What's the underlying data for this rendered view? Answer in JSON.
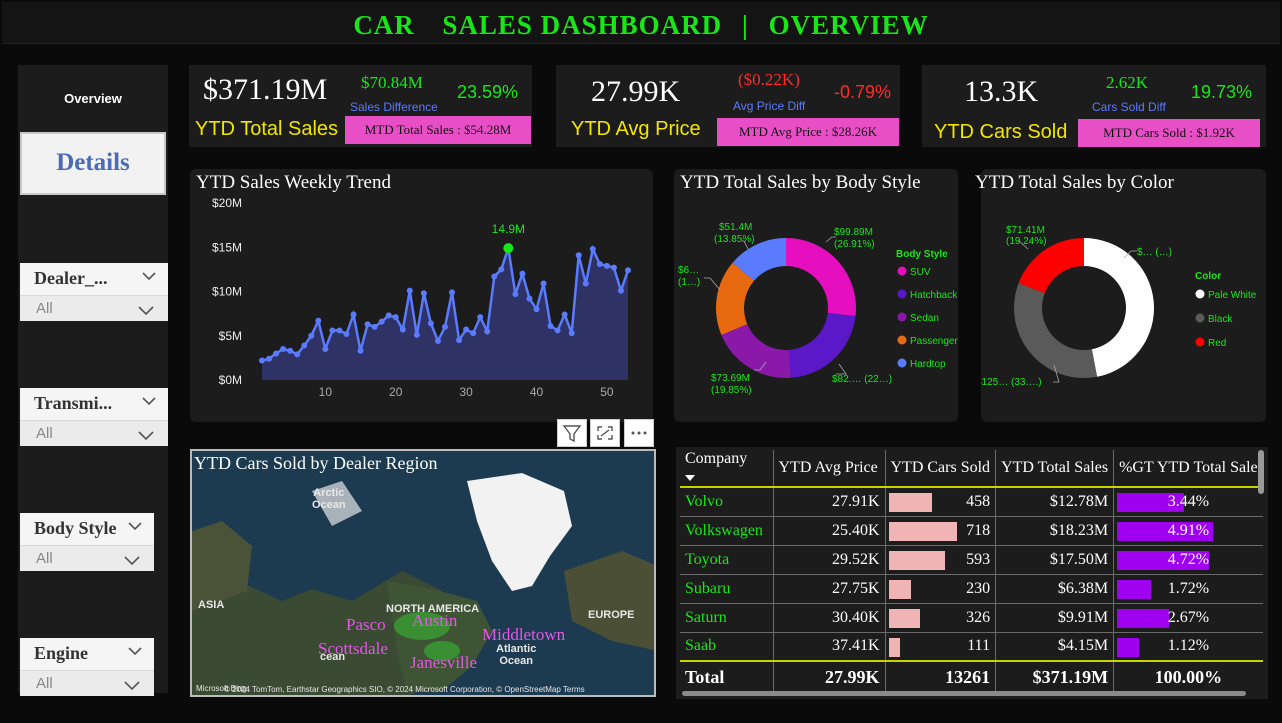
{
  "header": {
    "title_left": "CAR",
    "title_mid": "SALES DASHBOARD",
    "title_sep": "|",
    "title_right": "OVERVIEW"
  },
  "nav": {
    "overview": "Overview",
    "details": "Details"
  },
  "slicers": [
    {
      "label": "Dealer_...",
      "value": "All"
    },
    {
      "label": "Transmi...",
      "value": "All"
    },
    {
      "label": "Body Style",
      "value": "All"
    },
    {
      "label": "Engine",
      "value": "All"
    }
  ],
  "kpis": [
    {
      "value": "$371.19M",
      "label": "YTD Total Sales",
      "diff": "$70.84M",
      "diff_label": "Sales Difference",
      "pct": "23.59%",
      "mtd": "MTD Total Sales : $54.28M",
      "diff_color": "#19e619"
    },
    {
      "value": "27.99K",
      "label": "YTD Avg Price",
      "diff": "($0.22K)",
      "diff_label": "Avg Price Diff",
      "pct": "-0.79%",
      "mtd": "MTD Avg Price : $28.26K",
      "diff_color": "#ff2a2a"
    },
    {
      "value": "13.3K",
      "label": "YTD Cars Sold",
      "diff": "2.62K",
      "diff_label": "Cars Sold Diff",
      "pct": "19.73%",
      "mtd": "MTD Cars Sold : $1.92K",
      "diff_color": "#19e619"
    }
  ],
  "trend": {
    "title": "YTD Sales Weekly Trend",
    "peak_label": "14.9M",
    "chart_data": {
      "type": "area",
      "x": [
        1,
        2,
        3,
        4,
        5,
        6,
        7,
        8,
        9,
        10,
        11,
        12,
        13,
        14,
        15,
        16,
        17,
        18,
        19,
        20,
        21,
        22,
        23,
        24,
        25,
        26,
        27,
        28,
        29,
        30,
        31,
        32,
        33,
        34,
        35,
        36,
        37,
        38,
        39,
        40,
        41,
        42,
        43,
        44,
        45,
        46,
        47,
        48,
        49,
        50,
        51,
        52,
        53
      ],
      "values": [
        2.2,
        2.4,
        3.0,
        3.5,
        3.3,
        2.9,
        3.9,
        5.0,
        6.7,
        3.5,
        5.6,
        5.6,
        5.2,
        7.4,
        3.3,
        6.3,
        6.0,
        6.6,
        7.3,
        7.1,
        5.7,
        10.1,
        5.1,
        9.8,
        6.4,
        4.4,
        6.0,
        9.9,
        4.5,
        5.7,
        5.3,
        7.1,
        5.5,
        11.7,
        12.5,
        14.9,
        9.7,
        12.0,
        9.2,
        8.0,
        10.9,
        6.1,
        5.6,
        7.4,
        5.3,
        14.1,
        10.9,
        14.8,
        13.1,
        12.9,
        12.7,
        10.1,
        12.4,
        1.0
      ],
      "yticks": [
        "$0M",
        "$5M",
        "$10M",
        "$15M",
        "$20M"
      ],
      "xticks": [
        10,
        20,
        30,
        40,
        50
      ],
      "ylim": [
        0,
        20
      ],
      "xlim": [
        1,
        53
      ]
    }
  },
  "body_style": {
    "title": "YTD Total Sales by Body Style",
    "legend_title": "Body Style",
    "chart_data": {
      "type": "pie",
      "categories": [
        "SUV",
        "Hatchback",
        "Sedan",
        "Passenger",
        "Hardtop"
      ],
      "values": [
        99.89,
        82.0,
        73.69,
        65.0,
        51.4
      ],
      "colors": [
        "#e60fbf",
        "#5b18c8",
        "#8a18a8",
        "#e86a10",
        "#5b7bff"
      ],
      "labels": [
        "$99.89M\n(26.91%)",
        "$82.... (22...)",
        "$73.69M\n(19.85%)",
        "$6...\n(1...)",
        "$51.4M\n(13.85%)"
      ]
    }
  },
  "color": {
    "title": "YTD Total Sales by Color",
    "legend_title": "Color",
    "chart_data": {
      "type": "pie",
      "categories": [
        "Pale White",
        "Black",
        "Red"
      ],
      "values": [
        174.5,
        125.3,
        71.41
      ],
      "colors": [
        "#ffffff",
        "#5a5a5a",
        "#ff0000"
      ],
      "labels": [
        "$... (...)",
        "$125... (33....)",
        "$71.41M\n(19.24%)"
      ]
    }
  },
  "map": {
    "title": "YTD Cars Sold by Dealer Region",
    "labels": {
      "arctic": "Arctic\nOcean",
      "asia": "ASIA",
      "na": "NORTH AMERICA",
      "europe": "EUROPE",
      "pacific": "cean",
      "atlantic": "Atlantic\nOcean"
    },
    "cities": [
      "Pasco",
      "Austin",
      "Middletown",
      "Scottsdale",
      "Janesville"
    ],
    "attribution": "© 2024 TomTom, Earthstar Geographics SIO, © 2024 Microsoft Corporation, © OpenStreetMap Terms",
    "brand": "Microsoft Bing"
  },
  "table": {
    "headers": [
      "Company",
      "YTD Avg Price",
      "YTD Cars Sold",
      "YTD Total Sales",
      "%GT YTD Total Sale"
    ],
    "rows": [
      {
        "company": "Volvo",
        "avg": "27.91K",
        "sold": "458",
        "sold_n": 458,
        "sales": "$12.78M",
        "pct": "3.44%",
        "pct_n": 3.44
      },
      {
        "company": "Volkswagen",
        "avg": "25.40K",
        "sold": "718",
        "sold_n": 718,
        "sales": "$18.23M",
        "pct": "4.91%",
        "pct_n": 4.91
      },
      {
        "company": "Toyota",
        "avg": "29.52K",
        "sold": "593",
        "sold_n": 593,
        "sales": "$17.50M",
        "pct": "4.72%",
        "pct_n": 4.72
      },
      {
        "company": "Subaru",
        "avg": "27.75K",
        "sold": "230",
        "sold_n": 230,
        "sales": "$6.38M",
        "pct": "1.72%",
        "pct_n": 1.72
      },
      {
        "company": "Saturn",
        "avg": "30.40K",
        "sold": "326",
        "sold_n": 326,
        "sales": "$9.91M",
        "pct": "2.67%",
        "pct_n": 2.67
      },
      {
        "company": "Saab",
        "avg": "37.41K",
        "sold": "111",
        "sold_n": 111,
        "sales": "$4.15M",
        "pct": "1.12%",
        "pct_n": 1.12
      }
    ],
    "total": {
      "label": "Total",
      "avg": "27.99K",
      "sold": "13261",
      "sales": "$371.19M",
      "pct": "100.00%"
    }
  }
}
